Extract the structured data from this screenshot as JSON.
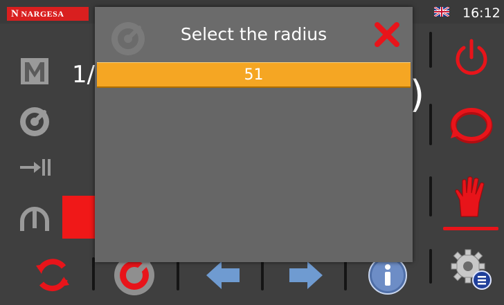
{
  "header": {
    "brand": "NARGESA",
    "brand_mark": "N",
    "time": "16:12",
    "language_flag": "uk-flag-icon"
  },
  "main": {
    "mode_value": "1/",
    "paren": ")"
  },
  "left_icons": [
    "m-mode-icon",
    "gauge-icon",
    "stop-arrow-icon",
    "arc-icon"
  ],
  "right_icons": [
    "power-icon",
    "cycle-icon",
    "manual-hand-icon",
    "settings-icon"
  ],
  "bottom_icons": [
    "reset-arrows-icon",
    "radius-gauge-icon",
    "arrow-left-icon",
    "arrow-right-icon",
    "info-icon"
  ],
  "dialog": {
    "title": "Select the radius",
    "options": [
      "51"
    ],
    "selected": "51"
  },
  "colors": {
    "accent_red": "#e8141a",
    "selection_orange": "#f5a623",
    "background": "#3f3f3f",
    "dialog": "#666666",
    "icon_gray": "#9a9a9a",
    "arrow_blue": "#6f9bd1"
  }
}
